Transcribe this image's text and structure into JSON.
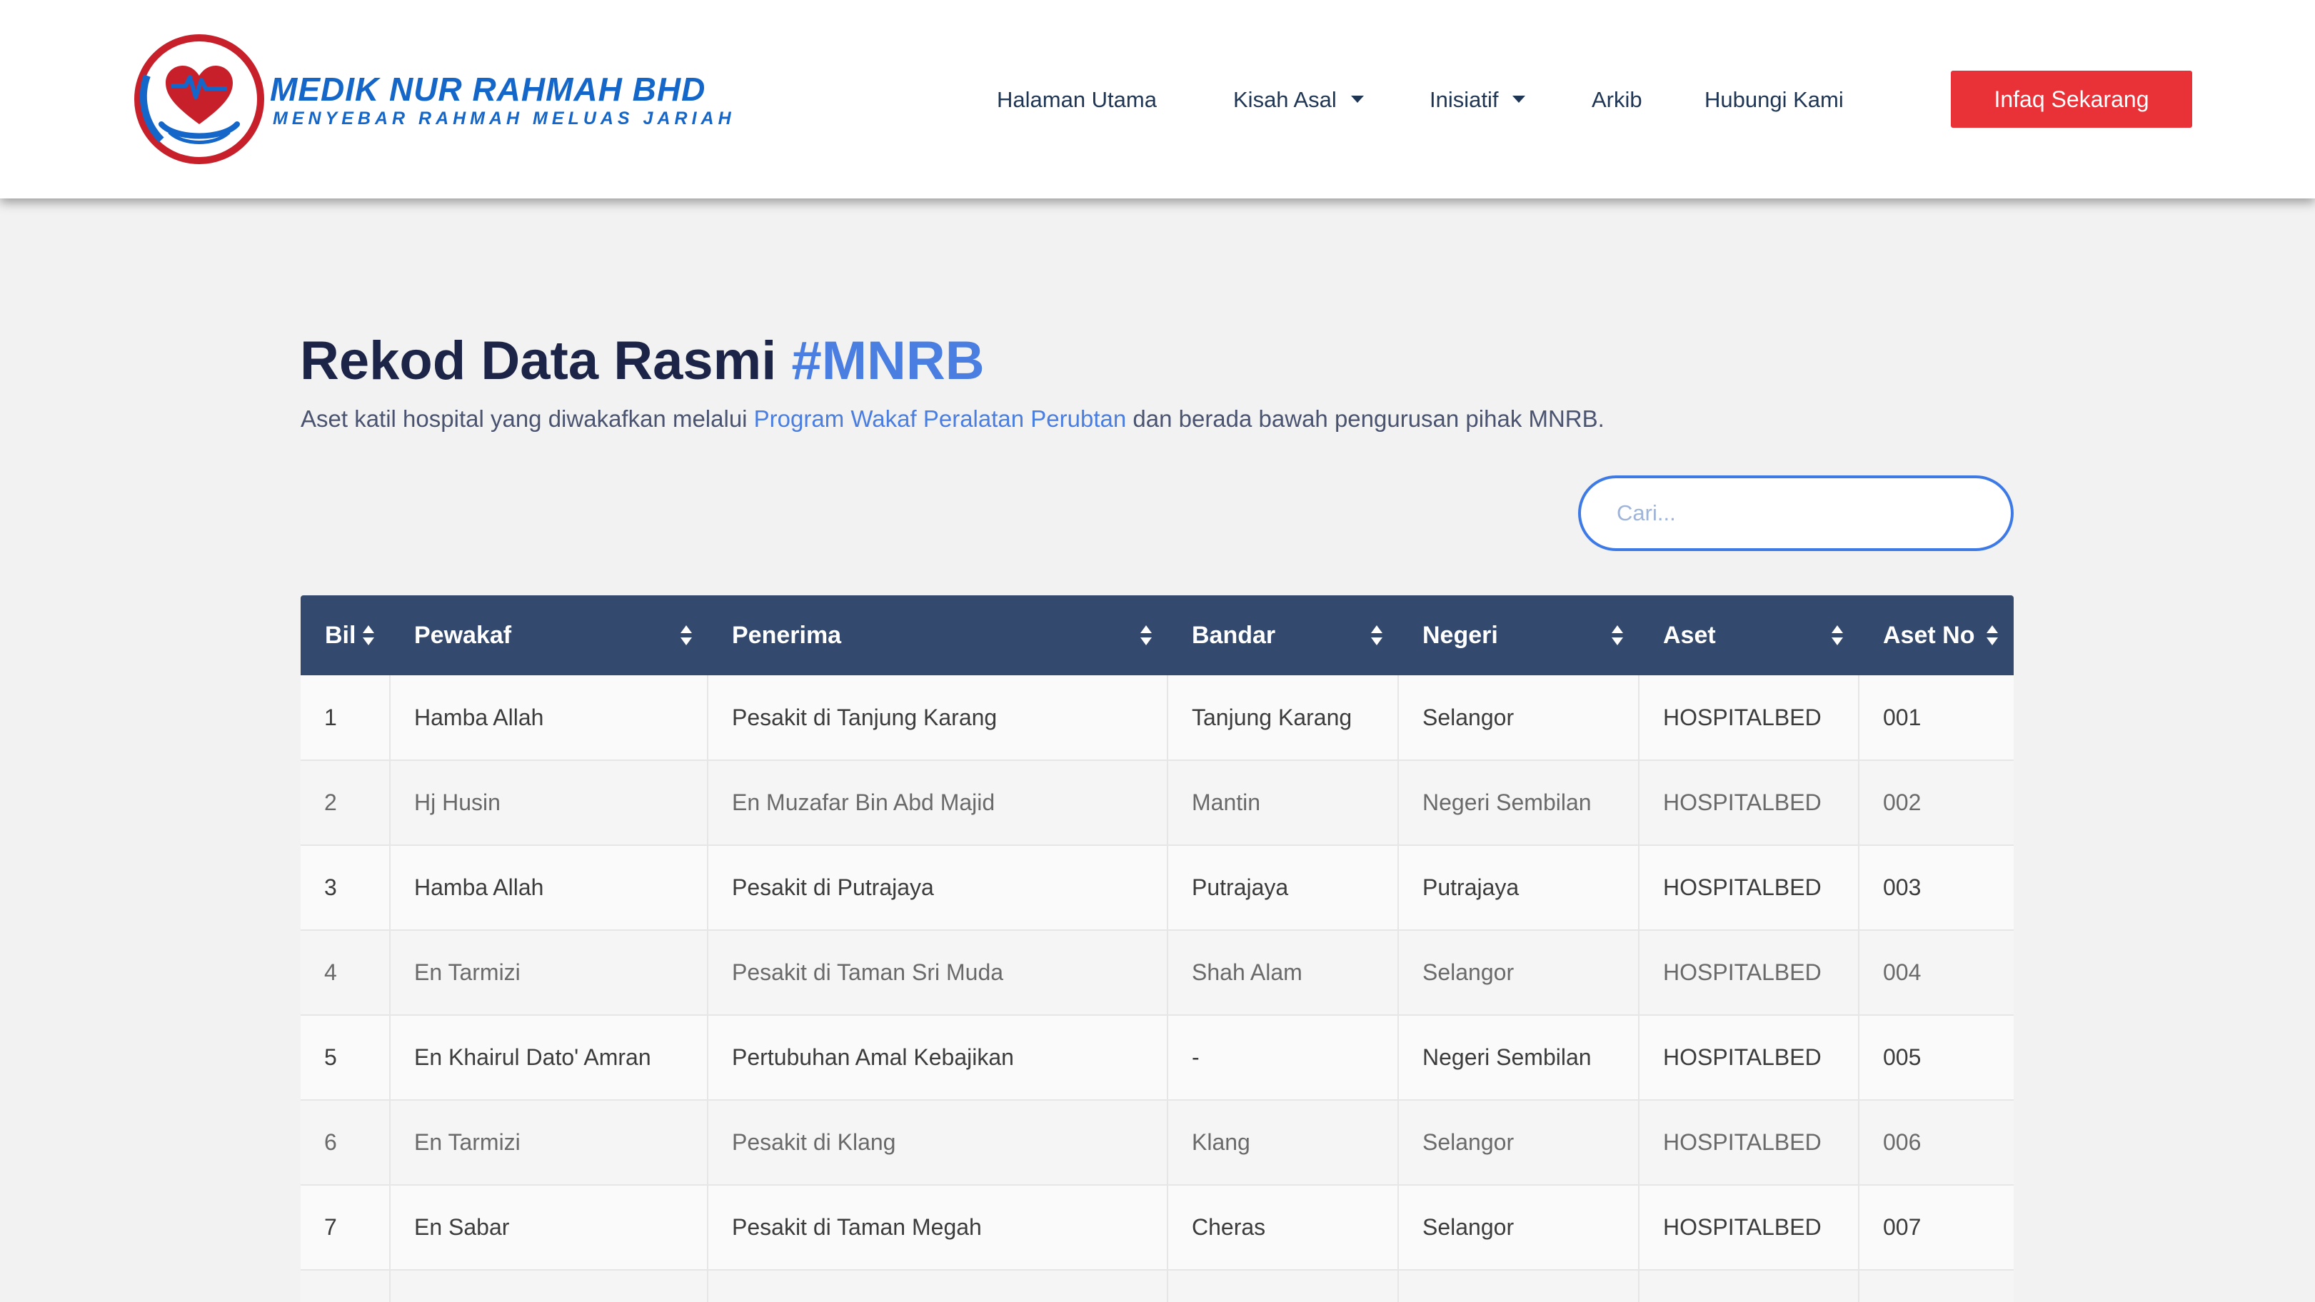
{
  "header": {
    "logo_title": "MEDIK NUR RAHMAH BHD",
    "logo_tagline": "MENYEBAR RAHMAH MELUAS JARIAH",
    "nav": [
      {
        "label": "Halaman Utama",
        "dropdown": false
      },
      {
        "label": "Kisah Asal",
        "dropdown": true
      },
      {
        "label": "Inisiatif",
        "dropdown": true
      },
      {
        "label": "Arkib",
        "dropdown": false
      },
      {
        "label": "Hubungi Kami",
        "dropdown": false
      }
    ],
    "cta_label": "Infaq Sekarang"
  },
  "main": {
    "title_main": "Rekod Data Rasmi ",
    "title_hash": "#MNRB",
    "subtitle_pre": "Aset katil hospital yang diwakafkan melalui ",
    "subtitle_link": "Program Wakaf Peralatan Perubtan",
    "subtitle_post": " dan berada bawah pengurusan pihak MNRB.",
    "search_placeholder": "Cari..."
  },
  "table": {
    "columns": [
      "Bil",
      "Pewakaf",
      "Penerima",
      "Bandar",
      "Negeri",
      "Aset",
      "Aset No"
    ],
    "rows": [
      [
        "1",
        "Hamba Allah",
        "Pesakit di Tanjung Karang",
        "Tanjung Karang",
        "Selangor",
        "HOSPITALBED",
        "001"
      ],
      [
        "2",
        "Hj Husin",
        "En Muzafar Bin Abd Majid",
        "Mantin",
        "Negeri Sembilan",
        "HOSPITALBED",
        "002"
      ],
      [
        "3",
        "Hamba Allah",
        "Pesakit di Putrajaya",
        "Putrajaya",
        "Putrajaya",
        "HOSPITALBED",
        "003"
      ],
      [
        "4",
        "En Tarmizi",
        "Pesakit di Taman Sri Muda",
        "Shah Alam",
        "Selangor",
        "HOSPITALBED",
        "004"
      ],
      [
        "5",
        "En Khairul Dato' Amran",
        "Pertubuhan Amal Kebajikan",
        "-",
        "Negeri Sembilan",
        "HOSPITALBED",
        "005"
      ],
      [
        "6",
        "En Tarmizi",
        "Pesakit di Klang",
        "Klang",
        "Selangor",
        "HOSPITALBED",
        "006"
      ],
      [
        "7",
        "En Sabar",
        "Pesakit di Taman Megah",
        "Cheras",
        "Selangor",
        "HOSPITALBED",
        "007"
      ],
      [
        "",
        "",
        "",
        "",
        "",
        "",
        ""
      ]
    ]
  },
  "colors": {
    "brand_blue": "#1466c8",
    "brand_red": "#c8202a",
    "accent_blue": "#4a7ee0",
    "table_header": "#33496e",
    "cta_red": "#e83238"
  }
}
